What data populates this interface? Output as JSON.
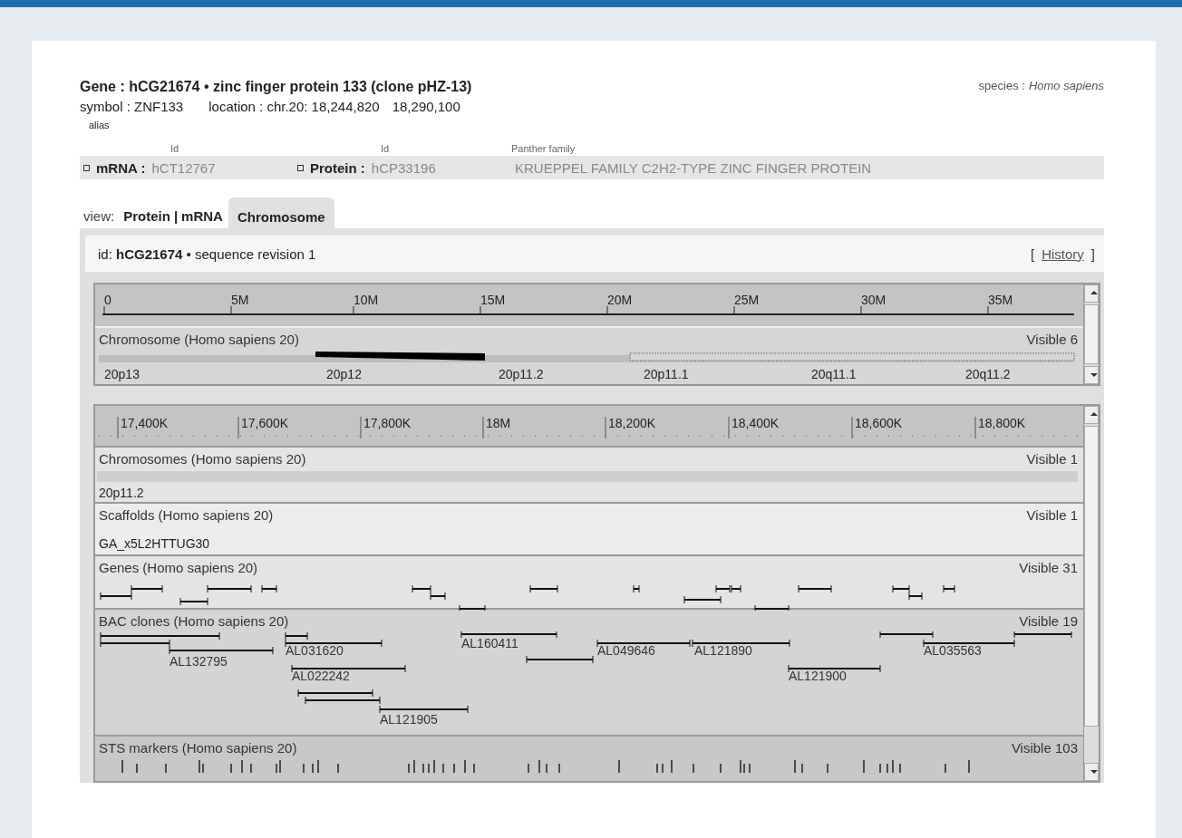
{
  "gene": {
    "title": "Gene : hCG21674 • zinc finger protein 133 (clone pHZ-13)",
    "species_label": "species :",
    "species": "Homo sapiens",
    "symbol": "symbol : ZNF133",
    "location": "location : chr.20: 18,244,820",
    "location_end": "18,290,100",
    "alias": "alias"
  },
  "products": {
    "columns": [
      "Id",
      "Id",
      "Panther family"
    ],
    "row": {
      "mrna_label": "mRNA :",
      "mrna_id": "hCT12767",
      "protein_label": "Protein :",
      "protein_id": "hCP33196",
      "family": "KRUEPPEL FAMILY C2H2-TYPE ZINC FINGER PROTEIN"
    }
  },
  "view_label": "view:",
  "tab_separator": "|",
  "tabs": [
    {
      "label": "Protein",
      "selected": false
    },
    {
      "label": "mRNA",
      "selected": false
    },
    {
      "label": "Chromosome",
      "selected": true
    }
  ],
  "panel_header": {
    "text": "id: **hCG21674** • sequence revision 1",
    "history_open": "[",
    "history": "History",
    "history_close": "]"
  },
  "overview": {
    "ticks": [
      "0",
      "5M",
      "10M",
      "15M",
      "20M",
      "25M",
      "30M",
      "35M"
    ],
    "track_title": "Chromosome (Homo sapiens 20)",
    "visible": "Visible 6",
    "bands": [
      "20p13",
      "20p12",
      "20p11.2",
      "20p11.1",
      "20q11.1",
      "20q11.2"
    ]
  },
  "detail": {
    "ticks": [
      "17,400K",
      "17,600K",
      "17,800K",
      "18M",
      "18,200K",
      "18,400K",
      "18,600K",
      "18,800K"
    ],
    "tracks": [
      {
        "kind": "band",
        "title": "Chromosomes (Homo sapiens 20)",
        "visible": "Visible 1",
        "label": "20p11.2"
      },
      {
        "kind": "scaffold",
        "title": "Scaffolds (Homo sapiens 20)",
        "visible": "Visible 1",
        "label": "GA_x5L2HTTUG30"
      },
      {
        "kind": "genes",
        "title": "Genes (Homo sapiens 20)",
        "visible": "Visible 31"
      },
      {
        "kind": "clones",
        "title": "BAC clones (Homo sapiens 20)",
        "visible": "Visible 19",
        "clones": [
          "AL132795",
          "AL031620",
          "AL022242",
          "AL121905",
          "AL160411",
          "AL049646",
          "AL121890",
          "AL121900",
          "AL035563"
        ]
      },
      {
        "kind": "markers",
        "title": "STS markers (Homo sapiens 20)",
        "visible": "Visible 103"
      }
    ]
  }
}
